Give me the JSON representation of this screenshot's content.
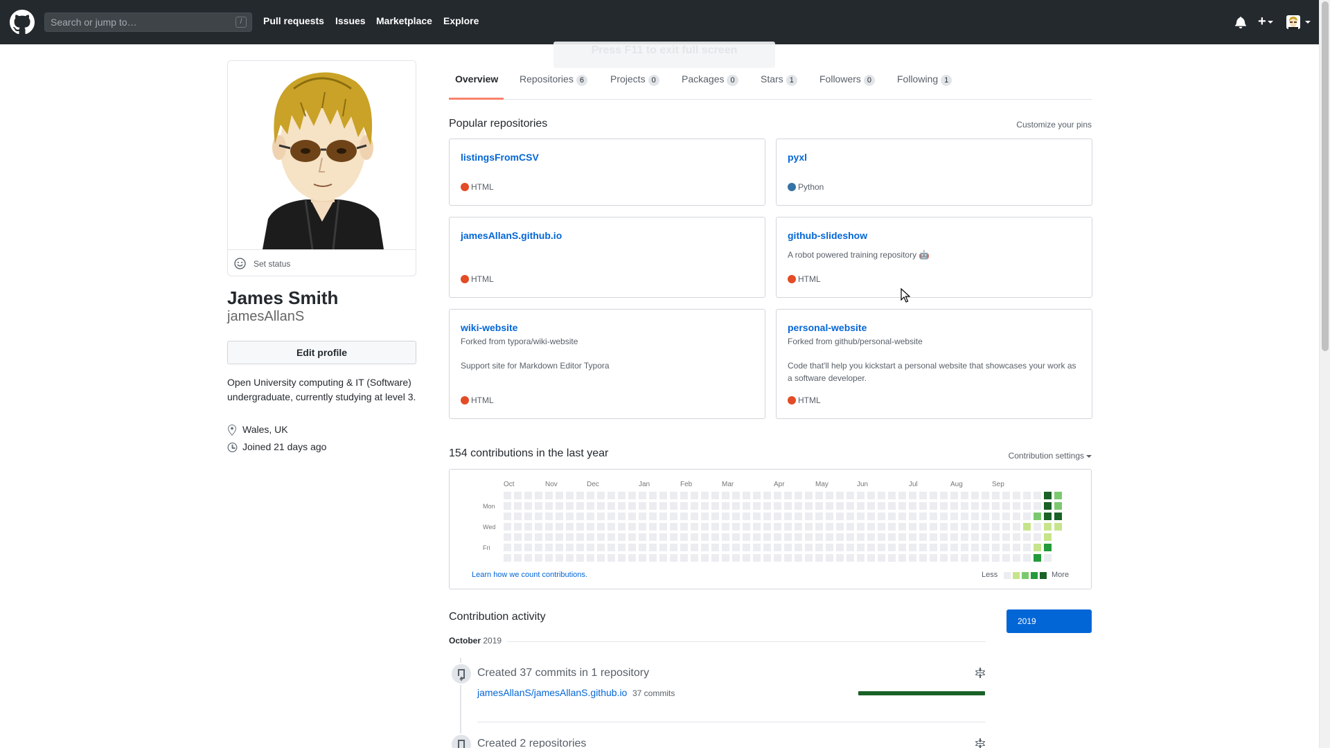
{
  "header": {
    "search_placeholder": "Search or jump to…",
    "search_shortcut": "/",
    "nav": [
      "Pull requests",
      "Issues",
      "Marketplace",
      "Explore"
    ],
    "plus": "+",
    "ghost_banner": "Press F11 to exit full screen"
  },
  "profile": {
    "set_status": "Set status",
    "full_name": "James Smith",
    "username": "jamesAllanS",
    "edit_button": "Edit profile",
    "bio": "Open University computing & IT (Software) undergraduate, currently studying at level 3.",
    "location": "Wales, UK",
    "joined": "Joined 21 days ago"
  },
  "tabs": [
    {
      "label": "Overview",
      "count": null
    },
    {
      "label": "Repositories",
      "count": "6"
    },
    {
      "label": "Projects",
      "count": "0"
    },
    {
      "label": "Packages",
      "count": "0"
    },
    {
      "label": "Stars",
      "count": "1"
    },
    {
      "label": "Followers",
      "count": "0"
    },
    {
      "label": "Following",
      "count": "1"
    }
  ],
  "popular": {
    "title": "Popular repositories",
    "customize": "Customize your pins",
    "repos": [
      {
        "name": "listingsFromCSV",
        "fork": "",
        "desc": "",
        "lang": "HTML"
      },
      {
        "name": "pyxl",
        "fork": "",
        "desc": "",
        "lang": "Python"
      },
      {
        "name": "jamesAllanS.github.io",
        "fork": "",
        "desc": "",
        "lang": "HTML"
      },
      {
        "name": "github-slideshow",
        "fork": "",
        "desc": "A robot powered training repository 🤖",
        "lang": "HTML"
      },
      {
        "name": "wiki-website",
        "fork": "Forked from typora/wiki-website",
        "desc": "Support site for Markdown Editor Typora",
        "lang": "HTML"
      },
      {
        "name": "personal-website",
        "fork": "Forked from github/personal-website",
        "desc": "Code that'll help you kickstart a personal website that showcases your work as a software developer.",
        "lang": "HTML"
      }
    ]
  },
  "colors": {
    "html_lang": "#e34c26",
    "python_lang": "#3572a5",
    "level0": "#ebedf0",
    "level1": "#c6e48b",
    "level2": "#7bc96f",
    "level3": "#239a3b",
    "level4": "#196127",
    "link": "#0366d6"
  },
  "contributions": {
    "title": "154 contributions in the last year",
    "settings": "Contribution settings",
    "months": [
      "Oct",
      "Nov",
      "Dec",
      "Jan",
      "Feb",
      "Mar",
      "Apr",
      "May",
      "Jun",
      "Jul",
      "Aug",
      "Sep"
    ],
    "days": [
      "Mon",
      "Wed",
      "Fri"
    ],
    "learn": "Learn how we count contributions.",
    "less": "Less",
    "more": "More",
    "active_cells": [
      {
        "week": 50,
        "day": 3,
        "level": 1
      },
      {
        "week": 51,
        "day": 2,
        "level": 2
      },
      {
        "week": 51,
        "day": 5,
        "level": 1
      },
      {
        "week": 51,
        "day": 6,
        "level": 3
      },
      {
        "week": 52,
        "day": 0,
        "level": 4
      },
      {
        "week": 52,
        "day": 1,
        "level": 4
      },
      {
        "week": 52,
        "day": 2,
        "level": 4
      },
      {
        "week": 52,
        "day": 3,
        "level": 1
      },
      {
        "week": 52,
        "day": 4,
        "level": 1
      },
      {
        "week": 52,
        "day": 5,
        "level": 3
      },
      {
        "week": 53,
        "day": 0,
        "level": 2
      },
      {
        "week": 53,
        "day": 1,
        "level": 2
      },
      {
        "week": 53,
        "day": 2,
        "level": 4
      },
      {
        "week": 53,
        "day": 3,
        "level": 1
      }
    ]
  },
  "activity": {
    "title": "Contribution activity",
    "year": "2019",
    "month": "October",
    "month_year": "2019",
    "item1_title": "Created 37 commits in 1 repository",
    "item1_repo": "jamesAllanS/jamesAllanS.github.io",
    "item1_count": "37 commits",
    "item1_fraction": 1.0,
    "item2_title": "Created 2 repositories"
  }
}
